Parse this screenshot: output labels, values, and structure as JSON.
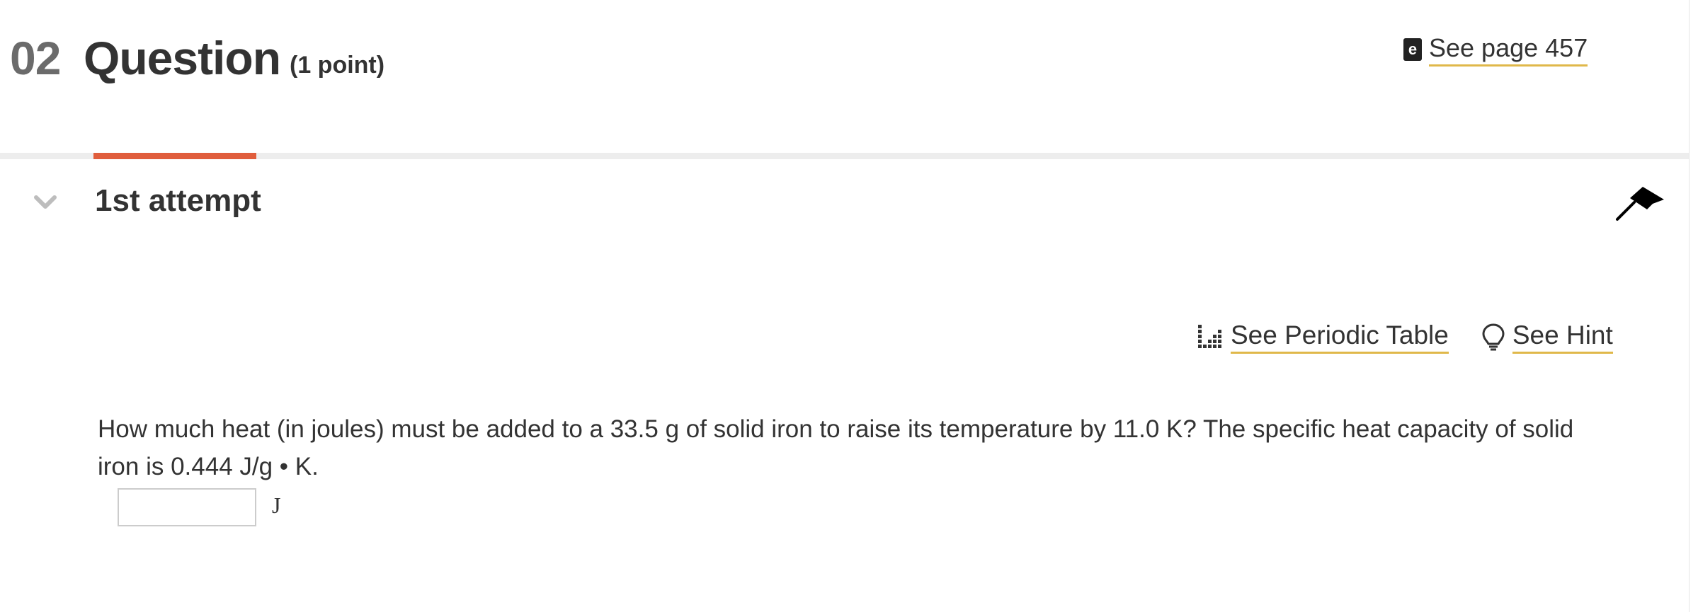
{
  "header": {
    "question_number": "02",
    "title": "Question",
    "points": "(1 point)",
    "book_link": {
      "icon": "ebook-icon",
      "icon_glyph": "e",
      "label": "See page 457"
    }
  },
  "attempt": {
    "label": "1st attempt",
    "chevron_icon": "chevron-down-icon",
    "flag_icon": "flag-icon"
  },
  "tools": {
    "periodic_table": {
      "icon": "periodic-table-icon",
      "label": "See Periodic Table"
    },
    "hint": {
      "icon": "lightbulb-icon",
      "label": "See Hint"
    }
  },
  "question": {
    "text": "How much heat (in joules) must be added to a 33.5  g of solid iron to raise its temperature by 11.0 K? The specific heat capacity of solid iron is 0.444 J/g • K.",
    "answer_value": "",
    "unit": "J"
  },
  "colors": {
    "accent_tab": "#e05d3c",
    "link_underline": "#e0b84a",
    "divider": "#ededed",
    "text": "#333333",
    "number_gray": "#6b6b6b"
  }
}
